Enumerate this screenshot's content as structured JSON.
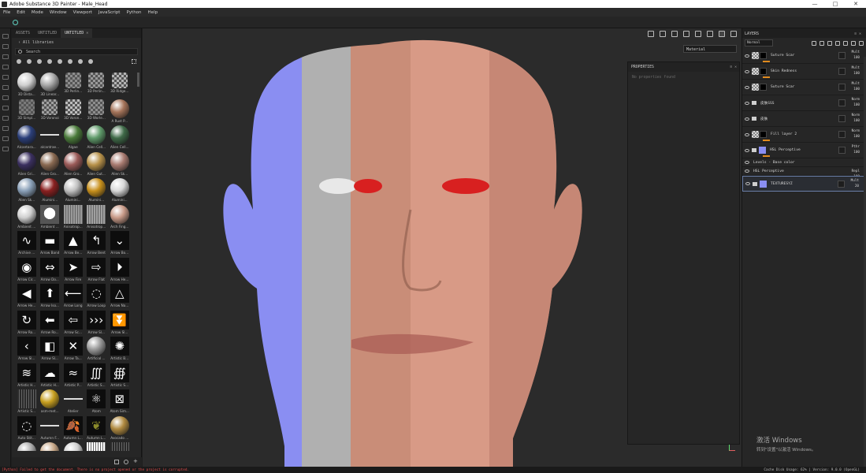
{
  "window": {
    "title": "Adobe Substance 3D Painter - Male_Head",
    "controls": [
      "—",
      "□",
      "✕"
    ]
  },
  "menu": [
    "File",
    "Edit",
    "Mode",
    "Window",
    "Viewport",
    "JavaScript",
    "Python",
    "Help"
  ],
  "assets": {
    "tabs": [
      {
        "label": "ASSETS",
        "active": false
      },
      {
        "label": "UNTITLED",
        "active": false
      },
      {
        "label": "UNTITLED",
        "active": true
      }
    ],
    "close_glyph": "✕",
    "breadcrumb": "›  All libraries",
    "search_placeholder": "Search",
    "items": [
      {
        "label": "3D Dista...",
        "color": "#d0d0d0",
        "shape": "sphere"
      },
      {
        "label": "3D Linear...",
        "color": "#a8a8a8",
        "shape": "sphere"
      },
      {
        "label": "3D Perlin...",
        "color": "#8c8c8c",
        "shape": "cube"
      },
      {
        "label": "3D Perlin...",
        "color": "#9a9a9a",
        "shape": "cube"
      },
      {
        "label": "3D Ridge...",
        "color": "#b4b4b4",
        "shape": "cube"
      },
      {
        "label": "3D Simpl...",
        "color": "#7a7a7a",
        "shape": "cube"
      },
      {
        "label": "3D Voronoi",
        "color": "#a0a0a0",
        "shape": "cube"
      },
      {
        "label": "3D Voron...",
        "color": "#bcbcbc",
        "shape": "cube"
      },
      {
        "label": "3D Worle...",
        "color": "#8e8e8e",
        "shape": "cube"
      },
      {
        "label": "A Rust P...",
        "color": "#a5745a",
        "shape": "sphere"
      },
      {
        "label": "Alcantara...",
        "color": "#2b3f7a",
        "shape": "sphere"
      },
      {
        "label": "alcantrae...",
        "color": "#1c1c1c",
        "shape": "line"
      },
      {
        "label": "Algae",
        "color": "#4a7a3a",
        "shape": "sphere"
      },
      {
        "label": "Alien Cell...",
        "color": "#5f9a6a",
        "shape": "sphere"
      },
      {
        "label": "Alien Cell...",
        "color": "#3f6a48",
        "shape": "sphere"
      },
      {
        "label": "Alien Gri...",
        "color": "#3b3060",
        "shape": "sphere"
      },
      {
        "label": "Alien Gro...",
        "color": "#8a6a52",
        "shape": "sphere"
      },
      {
        "label": "Alien Gro...",
        "color": "#9a5a58",
        "shape": "sphere"
      },
      {
        "label": "Alien Gut...",
        "color": "#b8924a",
        "shape": "sphere"
      },
      {
        "label": "Alien Sk...",
        "color": "#a87a70",
        "shape": "sphere"
      },
      {
        "label": "Alien Sk...",
        "color": "#8aa0b8",
        "shape": "sphere"
      },
      {
        "label": "Alumini...",
        "color": "#8a2020",
        "shape": "sphere"
      },
      {
        "label": "Alumini...",
        "color": "#c0c0c0",
        "shape": "sphere"
      },
      {
        "label": "Alumini...",
        "color": "#c8901c",
        "shape": "sphere"
      },
      {
        "label": "Alumini...",
        "color": "#d8d8d8",
        "shape": "sphere"
      },
      {
        "label": "Ambient ...",
        "color": "#cfcfcf",
        "shape": "sphere"
      },
      {
        "label": "Ambient ...",
        "color": "#f0f0f0",
        "shape": "face"
      },
      {
        "label": "Anisotrop...",
        "color": "#9a9a9a",
        "shape": "square"
      },
      {
        "label": "Anisotrop...",
        "color": "#a0a0a0",
        "shape": "square"
      },
      {
        "label": "Arch Fing...",
        "color": "#c89a88",
        "shape": "sphere"
      },
      {
        "label": "Archive ...",
        "color": "#ffffff",
        "shape": "glyph",
        "glyph": "∿"
      },
      {
        "label": "Arrow Band",
        "color": "#ffffff",
        "shape": "glyph",
        "glyph": "▬"
      },
      {
        "label": "Arrow Be...",
        "color": "#ffffff",
        "shape": "glyph",
        "glyph": "▲"
      },
      {
        "label": "Arrow Bent",
        "color": "#ffffff",
        "shape": "glyph",
        "glyph": "↰"
      },
      {
        "label": "Arrow Bo...",
        "color": "#ffffff",
        "shape": "glyph",
        "glyph": "⌄"
      },
      {
        "label": "Arrow Cir...",
        "color": "#ffffff",
        "shape": "glyph",
        "glyph": "◉"
      },
      {
        "label": "Arrow Do...",
        "color": "#ffffff",
        "shape": "glyph",
        "glyph": "⇔"
      },
      {
        "label": "Arrow Fire",
        "color": "#ffffff",
        "shape": "glyph",
        "glyph": "➤"
      },
      {
        "label": "Arrow Flat",
        "color": "#ffffff",
        "shape": "glyph",
        "glyph": "⇨"
      },
      {
        "label": "Arrow He...",
        "color": "#ffffff",
        "shape": "glyph",
        "glyph": "⏵"
      },
      {
        "label": "Arrow He...",
        "color": "#ffffff",
        "shape": "glyph",
        "glyph": "◀"
      },
      {
        "label": "Arrow Iso...",
        "color": "#ffffff",
        "shape": "glyph",
        "glyph": "⬆"
      },
      {
        "label": "Arrow Long",
        "color": "#ffffff",
        "shape": "glyph",
        "glyph": "⟵"
      },
      {
        "label": "Arrow Loop",
        "color": "#ffffff",
        "shape": "glyph",
        "glyph": "◌"
      },
      {
        "label": "Arrow Na...",
        "color": "#ffffff",
        "shape": "glyph",
        "glyph": "△"
      },
      {
        "label": "Arrow Ro...",
        "color": "#ffffff",
        "shape": "glyph",
        "glyph": "↻"
      },
      {
        "label": "Arrow Ro...",
        "color": "#ffffff",
        "shape": "glyph",
        "glyph": "⬅"
      },
      {
        "label": "Arrow Sc...",
        "color": "#ffffff",
        "shape": "glyph",
        "glyph": "⇦"
      },
      {
        "label": "Arrow Sl...",
        "color": "#ffffff",
        "shape": "glyph",
        "glyph": "›››"
      },
      {
        "label": "Arrow Sl...",
        "color": "#ffffff",
        "shape": "glyph",
        "glyph": "⏬"
      },
      {
        "label": "Arrow Sl...",
        "color": "#ffffff",
        "shape": "glyph",
        "glyph": "‹"
      },
      {
        "label": "Arrow Sl...",
        "color": "#ffffff",
        "shape": "glyph",
        "glyph": "◧"
      },
      {
        "label": "Arrow Ta...",
        "color": "#ffffff",
        "shape": "glyph",
        "glyph": "✕"
      },
      {
        "label": "Artificial ...",
        "color": "#9a9a9a",
        "shape": "sphere"
      },
      {
        "label": "Artistic B...",
        "color": "#ffffff",
        "shape": "glyph",
        "glyph": "✺"
      },
      {
        "label": "Artistic H...",
        "color": "#ffffff",
        "shape": "glyph",
        "glyph": "≋"
      },
      {
        "label": "Artistic H...",
        "color": "#ffffff",
        "shape": "glyph",
        "glyph": "☁"
      },
      {
        "label": "Artistic P...",
        "color": "#ffffff",
        "shape": "glyph",
        "glyph": "≈"
      },
      {
        "label": "Artistic S...",
        "color": "#ffffff",
        "shape": "glyph",
        "glyph": "∭"
      },
      {
        "label": "Artistic S...",
        "color": "#ffffff",
        "shape": "glyph",
        "glyph": "∰"
      },
      {
        "label": "Artistic S...",
        "color": "#2a2a2a",
        "shape": "square"
      },
      {
        "label": "asm-met...",
        "color": "#c8a020",
        "shape": "sphere"
      },
      {
        "label": "Atelier",
        "color": "#2a2a2a",
        "shape": "line"
      },
      {
        "label": "Atom",
        "color": "#ffffff",
        "shape": "glyph",
        "glyph": "⚛"
      },
      {
        "label": "Atom Sim...",
        "color": "#ffffff",
        "shape": "glyph",
        "glyph": "⊠"
      },
      {
        "label": "Auto Stit...",
        "color": "#ffffff",
        "shape": "glyph",
        "glyph": "◌"
      },
      {
        "label": "Autumn F...",
        "color": "#2a2a2a",
        "shape": "line"
      },
      {
        "label": "Autumn L...",
        "color": "#8a5a2a",
        "shape": "glyph",
        "glyph": "🍂"
      },
      {
        "label": "Autumn L...",
        "color": "#8a8a2a",
        "shape": "glyph",
        "glyph": "❦"
      },
      {
        "label": "Avocado ...",
        "color": "#b08a40",
        "shape": "sphere"
      },
      {
        "label": "",
        "color": "#b0b0b0",
        "shape": "sphere"
      },
      {
        "label": "",
        "color": "#c8a888",
        "shape": "sphere"
      },
      {
        "label": "",
        "color": "#d0d0d0",
        "shape": "sphere"
      },
      {
        "label": "",
        "color": "#ffffff",
        "shape": "square"
      },
      {
        "label": "",
        "color": "#2a2a2a",
        "shape": "square"
      }
    ]
  },
  "viewport": {
    "material_select": "Material",
    "colors": {
      "normal": "#8a8ef2",
      "height": "#b0b0b0",
      "base": "#c98d78",
      "render": "#d89a86",
      "eye": "#d82020",
      "bg": "#2b2b2b"
    }
  },
  "properties": {
    "title": "PROPERTIES",
    "empty_text": "No properties found"
  },
  "layers": {
    "title": "LAYERS",
    "blend_mode": "Normal",
    "items": [
      {
        "name": "Suture Scar",
        "type": "fill",
        "blend": "Mult",
        "opacity": "100",
        "has_bar": true,
        "selected": false
      },
      {
        "name": "Skin Redness",
        "type": "fill",
        "blend": "Mult",
        "opacity": "100",
        "has_bar": true,
        "selected": false
      },
      {
        "name": "Suture Scar",
        "type": "fill",
        "blend": "Mult",
        "opacity": "100",
        "has_bar": false,
        "selected": false
      },
      {
        "name": "皮肤SSS",
        "type": "folder",
        "blend": "Norm",
        "opacity": "100",
        "has_bar": false,
        "selected": false
      },
      {
        "name": "皮肤",
        "type": "folder",
        "blend": "Norm",
        "opacity": "100",
        "has_bar": false,
        "selected": false
      },
      {
        "name": "Fill layer 2",
        "type": "fillmask",
        "blend": "Norm",
        "opacity": "100",
        "has_bar": true,
        "selected": false
      },
      {
        "name": "HSL Perceptive",
        "type": "color",
        "blend": "Pthr",
        "opacity": "100",
        "has_bar": true,
        "selected": false
      },
      {
        "name": "Levels - Base color",
        "type": "sub",
        "blend": "",
        "opacity": "",
        "has_bar": false,
        "selected": false
      },
      {
        "name": "HSL Perceptive",
        "type": "sub",
        "blend": "Repl",
        "opacity": "100",
        "has_bar": false,
        "selected": false
      },
      {
        "name": "TEXTURESYZ",
        "type": "folderthumb",
        "blend": "Mult",
        "opacity": "20",
        "has_bar": false,
        "selected": true
      }
    ]
  },
  "status": {
    "error": "[Python] Failed to get the document. There is no project opened or the project is corrupted.",
    "right": "Cache Disk Usage:  62%  |  Version: 9.0.0 (OpenGL)"
  },
  "watermark": {
    "line1": "激活 Windows",
    "line2": "转到\"设置\"以激活 Windows。"
  }
}
